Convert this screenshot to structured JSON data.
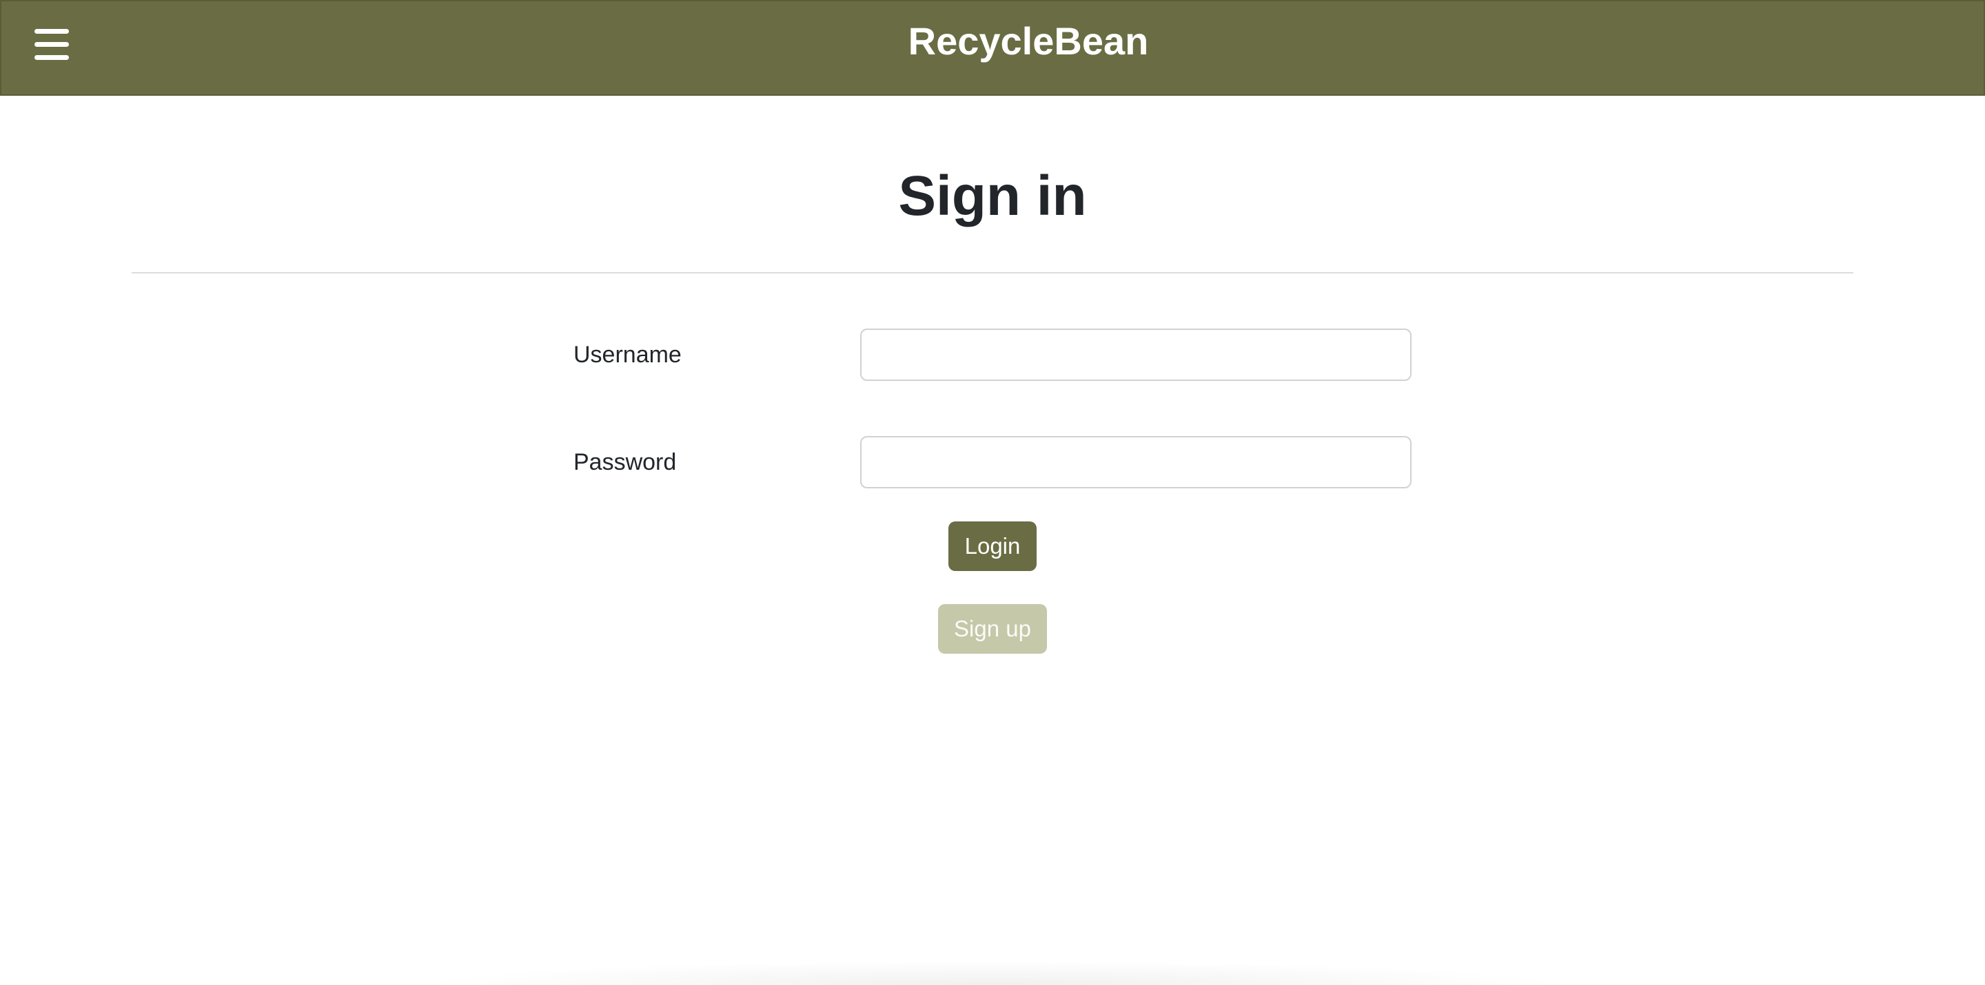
{
  "header": {
    "brand": "RecycleBean",
    "menu_icon": "hamburger-menu-icon",
    "background_color": "#6a6c43"
  },
  "page": {
    "title": "Sign in"
  },
  "form": {
    "username_label": "Username",
    "username_value": "",
    "username_placeholder": "",
    "password_label": "Password",
    "password_value": "",
    "password_placeholder": "",
    "login_label": "Login",
    "signup_label": "Sign up"
  },
  "colors": {
    "primary_button": "#6a6c43",
    "secondary_button": "#c5c8a9"
  }
}
